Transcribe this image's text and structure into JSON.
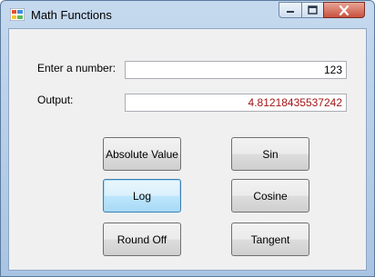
{
  "window": {
    "title": "Math Functions"
  },
  "form": {
    "input_label": "Enter a number:",
    "input_value": "123",
    "output_label": "Output:",
    "output_value": "4.81218435537242",
    "output_color": "#a31515"
  },
  "buttons": {
    "absolute_value": "Absolute Value",
    "sin": "Sin",
    "log": "Log",
    "cosine": "Cosine",
    "round_off": "Round Off",
    "tangent": "Tangent"
  },
  "icons": {
    "app": "app-icon",
    "minimize": "minimize-icon",
    "maximize": "maximize-icon",
    "close": "close-icon"
  }
}
